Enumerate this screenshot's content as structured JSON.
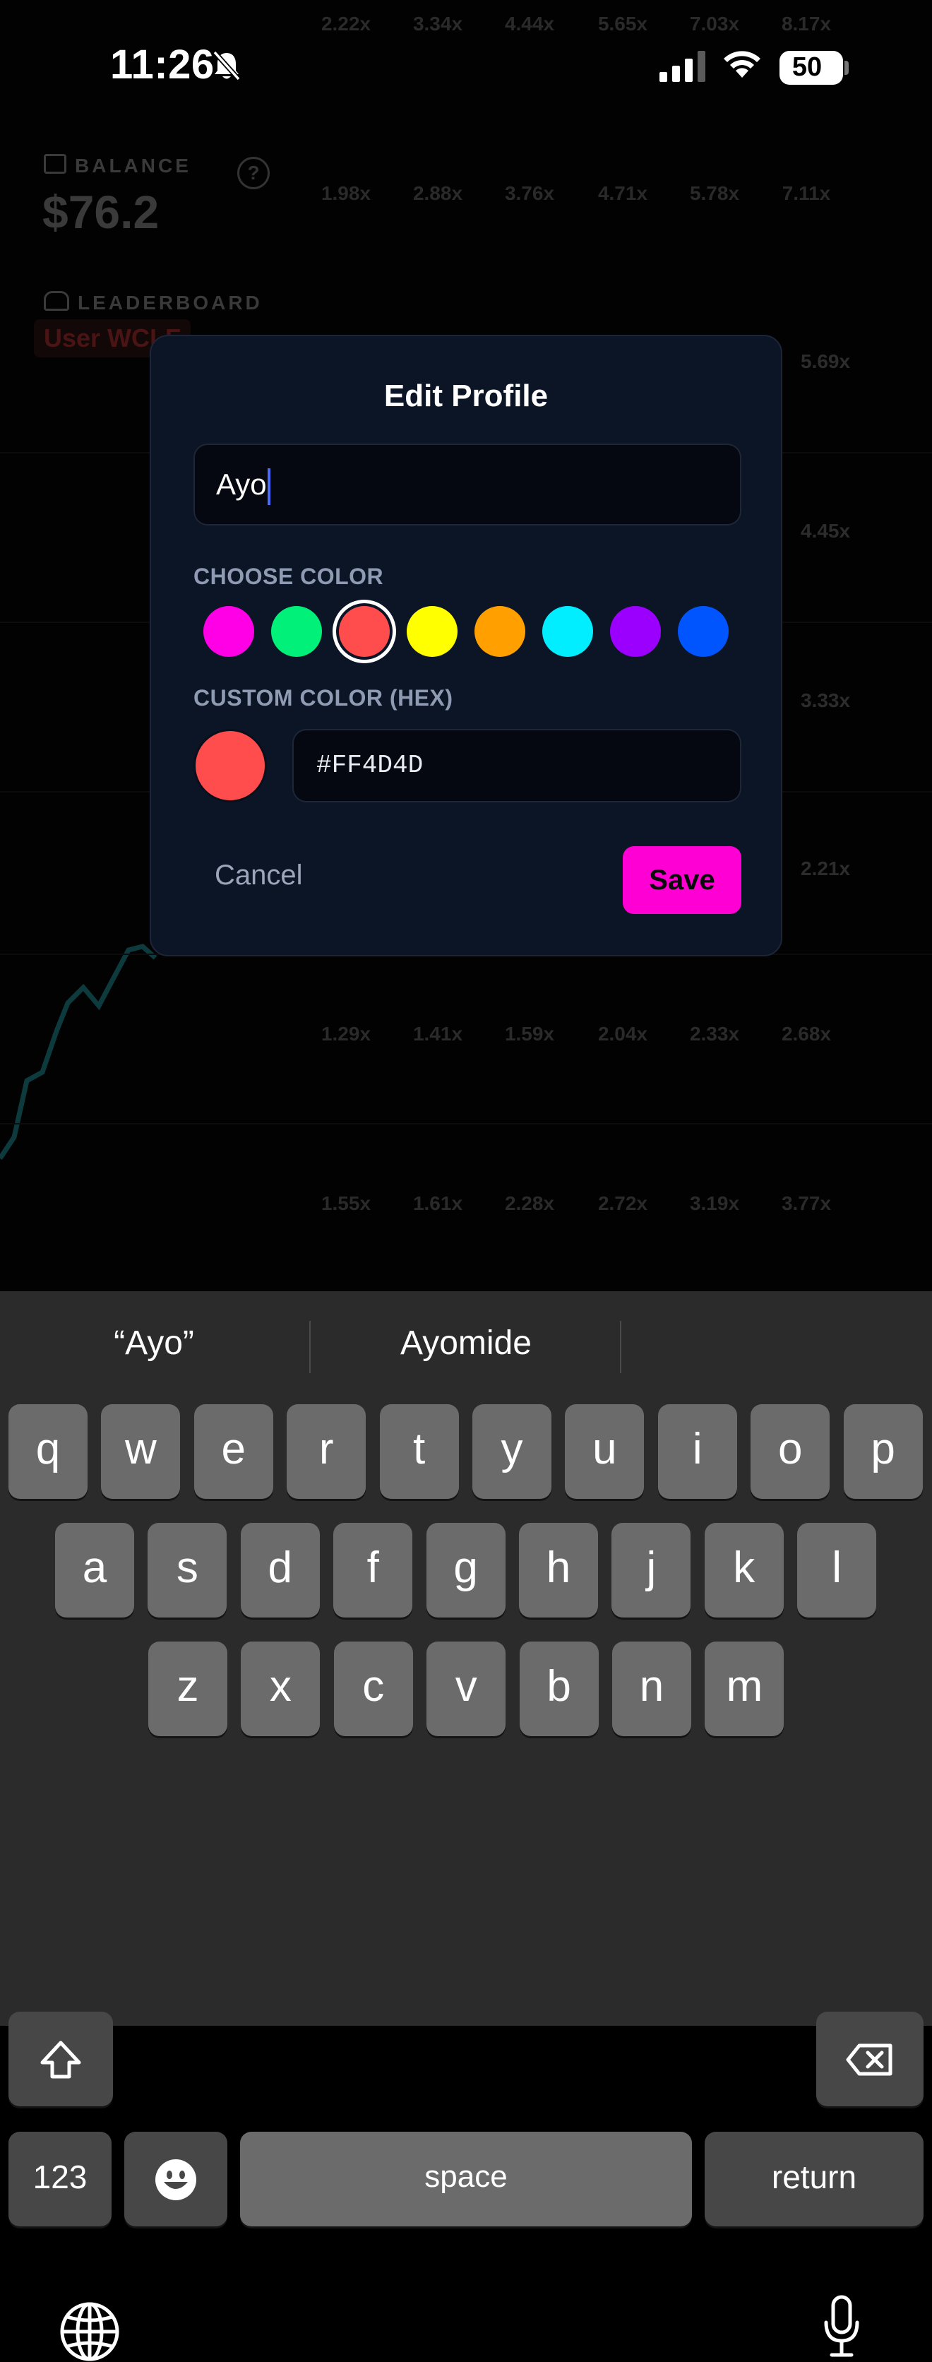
{
  "status_bar": {
    "time": "11:26",
    "battery": "50"
  },
  "background": {
    "balance_label": "BALANCE",
    "balance_value": "$76.2",
    "help_glyph": "?",
    "leaderboard_label": "LEADERBOARD",
    "leaderboard_user": "User WCLF",
    "grid_rows": [
      [
        "2.22x",
        "3.34x",
        "4.44x",
        "5.65x",
        "7.03x",
        "8.17x"
      ],
      [
        "1.98x",
        "2.88x",
        "3.76x",
        "4.71x",
        "5.78x",
        "7.11x"
      ],
      [
        "1.29x",
        "1.41x",
        "1.59x",
        "2.04x",
        "2.33x",
        "2.68x"
      ],
      [
        "1.55x",
        "1.61x",
        "2.28x",
        "2.72x",
        "3.19x",
        "3.77x"
      ]
    ],
    "side_multipliers": [
      "5.69x",
      "4.45x",
      "3.33x",
      "2.21x"
    ]
  },
  "modal": {
    "title": "Edit Profile",
    "name_value": "Ayo",
    "choose_color_label": "CHOOSE COLOR",
    "swatches": [
      "#FF00E6",
      "#00F07A",
      "#FF4D4D",
      "#FFFF00",
      "#FFA000",
      "#00EEFF",
      "#9B00FF",
      "#0055FF"
    ],
    "selected_swatch_index": 2,
    "custom_color_label": "CUSTOM COLOR (HEX)",
    "hex_value": "#FF4D4D",
    "custom_color": "#FF4D4D",
    "cancel_label": "Cancel",
    "save_label": "Save",
    "accent": "#FF00D4"
  },
  "keyboard": {
    "suggestions": [
      "“Ayo”",
      "Ayomide"
    ],
    "row1": [
      "q",
      "w",
      "e",
      "r",
      "t",
      "y",
      "u",
      "i",
      "o",
      "p"
    ],
    "row2": [
      "a",
      "s",
      "d",
      "f",
      "g",
      "h",
      "j",
      "k",
      "l"
    ],
    "row3": [
      "z",
      "x",
      "c",
      "v",
      "b",
      "n",
      "m"
    ],
    "numbers_label": "123",
    "space_label": "space",
    "return_label": "return"
  }
}
